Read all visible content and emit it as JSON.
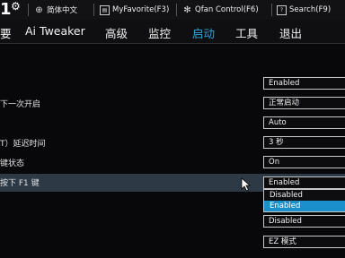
{
  "topbar": {
    "version_digit": "1",
    "language": "简体中文",
    "favorite": "MyFavorite(F3)",
    "qfan": "Qfan Control(F6)",
    "search": "Search(F9)"
  },
  "menu": {
    "items": [
      "要",
      "Ai Tweaker",
      "高级",
      "监控",
      "启动",
      "工具",
      "退出"
    ],
    "active_index": 4
  },
  "settings": [
    {
      "label": "",
      "value": "Enabled"
    },
    {
      "label": "下一次开启",
      "value": "正常启动"
    },
    {
      "label": "",
      "value": "Auto"
    },
    {
      "label": "T）延迟时间",
      "value": "3 秒"
    },
    {
      "label": "键状态",
      "value": "On"
    },
    {
      "label": "按下 F1 键",
      "value": "Enabled"
    },
    {
      "label": "",
      "value": "Disabled"
    },
    {
      "label": "",
      "value": "EZ 模式"
    }
  ],
  "dropdown": {
    "options": [
      "Disabled",
      "Enabled"
    ],
    "selected": "Enabled"
  },
  "colors": {
    "accent": "#2fa6d8",
    "highlight_row": "#2d3a46",
    "selected_option": "#1b8fcb"
  }
}
